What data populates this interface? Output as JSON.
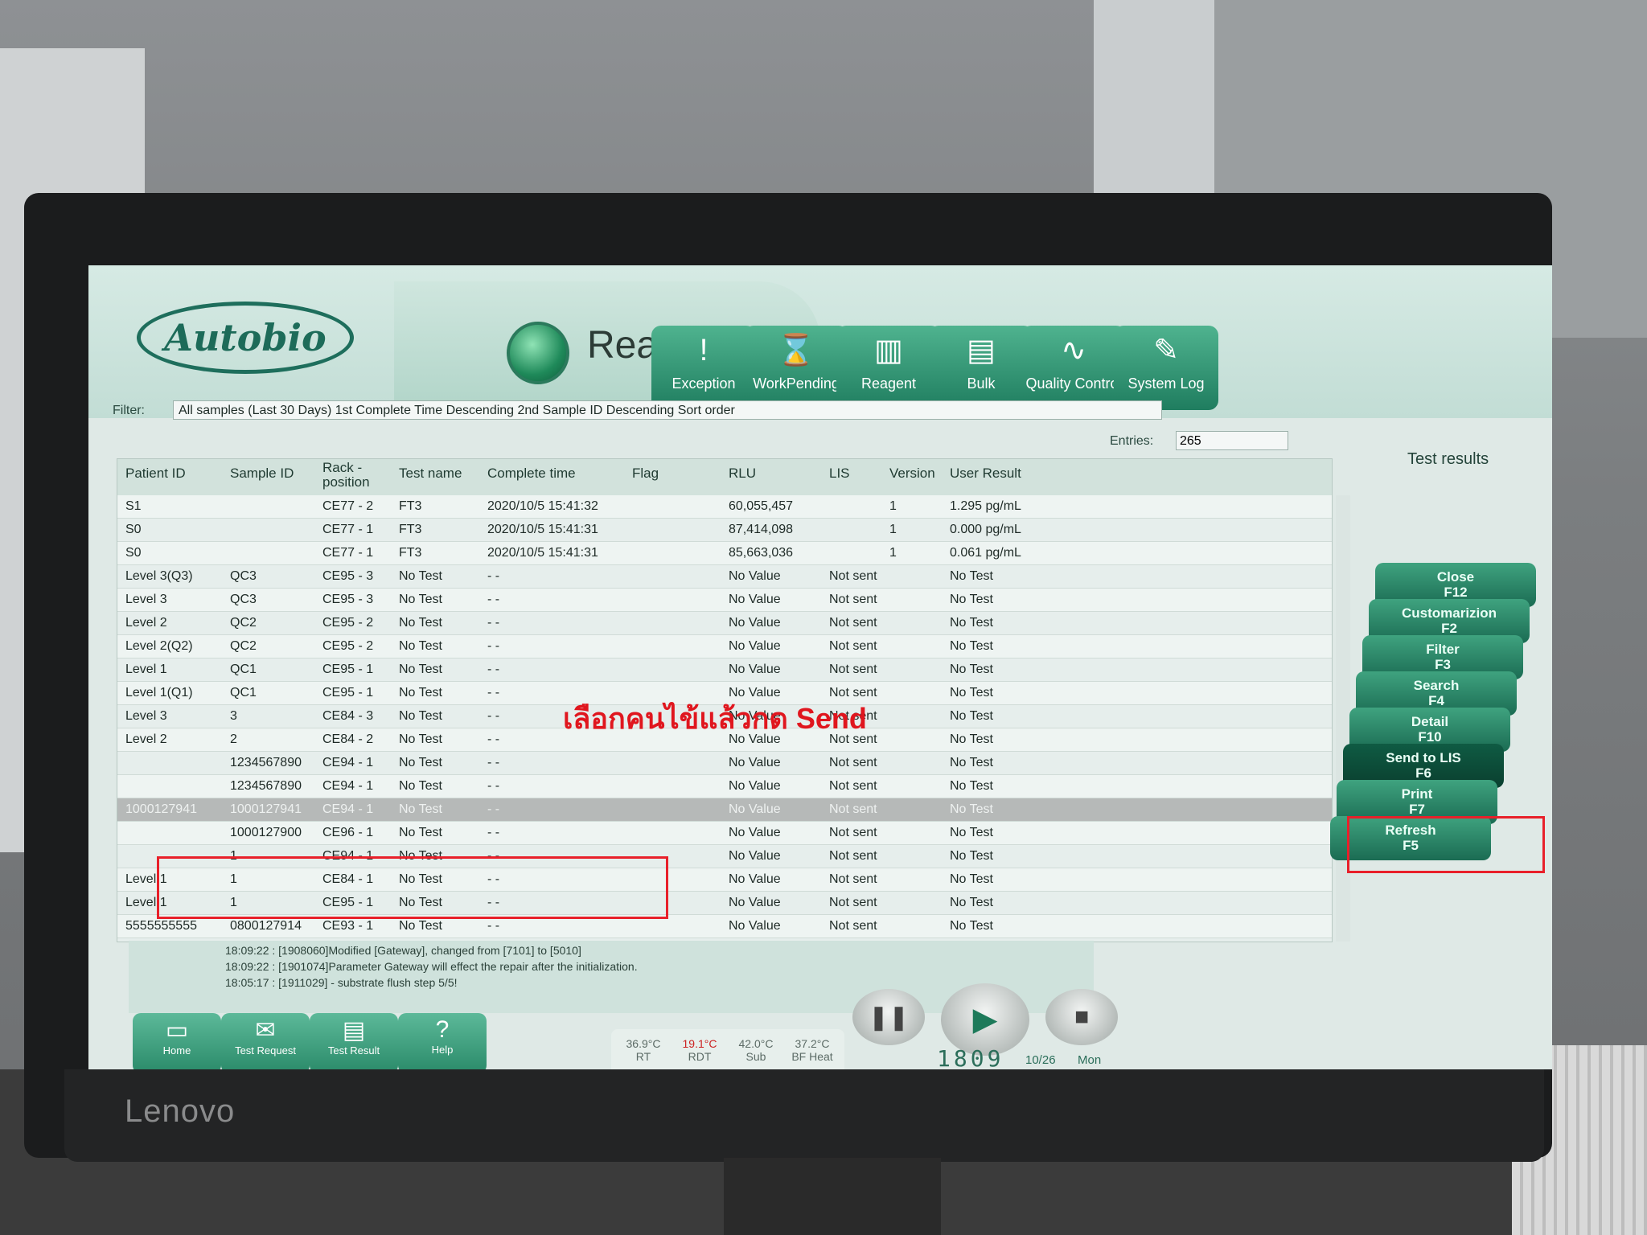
{
  "app": {
    "logo": "Autobio",
    "status": "Ready"
  },
  "top_buttons": [
    {
      "label": "Exception",
      "icon": "!"
    },
    {
      "label": "WorkPending",
      "icon": "⌛"
    },
    {
      "label": "Reagent",
      "icon": "▥"
    },
    {
      "label": "Bulk",
      "icon": "▤"
    },
    {
      "label": "Quality Control",
      "icon": "∿"
    },
    {
      "label": "System Log",
      "icon": "✎"
    }
  ],
  "filter": {
    "label": "Filter:",
    "value": "All samples (Last 30 Days)   1st Complete Time Descending 2nd Sample ID Descending Sort order",
    "entries_label": "Entries:",
    "entries_value": "265"
  },
  "panel_title": "Test results",
  "table": {
    "headers": {
      "patient_id": "Patient ID",
      "sample_id": "Sample ID",
      "rack": "Rack -\nposition",
      "test_name": "Test name",
      "complete_time": "Complete time",
      "flag": "Flag",
      "rlu": "RLU",
      "lis": "LIS",
      "version": "Version",
      "user_result": "User Result"
    },
    "rows": [
      {
        "patient": "S1",
        "sample": "",
        "rack": "CE77 - 2",
        "test": "FT3",
        "time": "2020/10/5 15:41:32",
        "flag": "",
        "rlu": "60,055,457",
        "lis": "",
        "version": "1",
        "result": "1.295 pg/mL"
      },
      {
        "patient": "S0",
        "sample": "",
        "rack": "CE77 - 1",
        "test": "FT3",
        "time": "2020/10/5 15:41:31",
        "flag": "",
        "rlu": "87,414,098",
        "lis": "",
        "version": "1",
        "result": "0.000 pg/mL"
      },
      {
        "patient": "S0",
        "sample": "",
        "rack": "CE77 - 1",
        "test": "FT3",
        "time": "2020/10/5 15:41:31",
        "flag": "",
        "rlu": "85,663,036",
        "lis": "",
        "version": "1",
        "result": "0.061 pg/mL"
      },
      {
        "patient": "Level 3(Q3)",
        "sample": "QC3",
        "rack": "CE95 - 3",
        "test": "No Test",
        "time": "- -",
        "flag": "",
        "rlu": "No Value",
        "lis": "Not sent",
        "version": "",
        "result": "No Test"
      },
      {
        "patient": "Level 3",
        "sample": "QC3",
        "rack": "CE95 - 3",
        "test": "No Test",
        "time": "- -",
        "flag": "",
        "rlu": "No Value",
        "lis": "Not sent",
        "version": "",
        "result": "No Test"
      },
      {
        "patient": "Level 2",
        "sample": "QC2",
        "rack": "CE95 - 2",
        "test": "No Test",
        "time": "- -",
        "flag": "",
        "rlu": "No Value",
        "lis": "Not sent",
        "version": "",
        "result": "No Test"
      },
      {
        "patient": "Level 2(Q2)",
        "sample": "QC2",
        "rack": "CE95 - 2",
        "test": "No Test",
        "time": "- -",
        "flag": "",
        "rlu": "No Value",
        "lis": "Not sent",
        "version": "",
        "result": "No Test"
      },
      {
        "patient": "Level 1",
        "sample": "QC1",
        "rack": "CE95 - 1",
        "test": "No Test",
        "time": "- -",
        "flag": "",
        "rlu": "No Value",
        "lis": "Not sent",
        "version": "",
        "result": "No Test"
      },
      {
        "patient": "Level 1(Q1)",
        "sample": "QC1",
        "rack": "CE95 - 1",
        "test": "No Test",
        "time": "- -",
        "flag": "",
        "rlu": "No Value",
        "lis": "Not sent",
        "version": "",
        "result": "No Test"
      },
      {
        "patient": "Level 3",
        "sample": "3",
        "rack": "CE84 - 3",
        "test": "No Test",
        "time": "- -",
        "flag": "",
        "rlu": "No Value",
        "lis": "Not sent",
        "version": "",
        "result": "No Test"
      },
      {
        "patient": "Level 2",
        "sample": "2",
        "rack": "CE84 - 2",
        "test": "No Test",
        "time": "- -",
        "flag": "",
        "rlu": "No Value",
        "lis": "Not sent",
        "version": "",
        "result": "No Test"
      },
      {
        "patient": "",
        "sample": "1234567890",
        "rack": "CE94 - 1",
        "test": "No Test",
        "time": "- -",
        "flag": "",
        "rlu": "No Value",
        "lis": "Not sent",
        "version": "",
        "result": "No Test"
      },
      {
        "patient": "",
        "sample": "1234567890",
        "rack": "CE94 - 1",
        "test": "No Test",
        "time": "- -",
        "flag": "",
        "rlu": "No Value",
        "lis": "Not sent",
        "version": "",
        "result": "No Test"
      },
      {
        "patient": "1000127941",
        "sample": "1000127941",
        "rack": "CE94 - 1",
        "test": "No Test",
        "time": "- -",
        "flag": "",
        "rlu": "No Value",
        "lis": "Not sent",
        "version": "",
        "result": "No Test",
        "selected": true
      },
      {
        "patient": "",
        "sample": "1000127900",
        "rack": "CE96 - 1",
        "test": "No Test",
        "time": "- -",
        "flag": "",
        "rlu": "No Value",
        "lis": "Not sent",
        "version": "",
        "result": "No Test"
      },
      {
        "patient": "",
        "sample": "1",
        "rack": "CE94 - 1",
        "test": "No Test",
        "time": "- -",
        "flag": "",
        "rlu": "No Value",
        "lis": "Not sent",
        "version": "",
        "result": "No Test"
      },
      {
        "patient": "Level 1",
        "sample": "1",
        "rack": "CE84 - 1",
        "test": "No Test",
        "time": "- -",
        "flag": "",
        "rlu": "No Value",
        "lis": "Not sent",
        "version": "",
        "result": "No Test"
      },
      {
        "patient": "Level 1",
        "sample": "1",
        "rack": "CE95 - 1",
        "test": "No Test",
        "time": "- -",
        "flag": "",
        "rlu": "No Value",
        "lis": "Not sent",
        "version": "",
        "result": "No Test"
      },
      {
        "patient": "5555555555",
        "sample": "0800127914",
        "rack": "CE93 - 1",
        "test": "No Test",
        "time": "- -",
        "flag": "",
        "rlu": "No Value",
        "lis": "Not sent",
        "version": "",
        "result": "No Test"
      }
    ]
  },
  "annotation": "เลือกคนไข้แล้วกด Send",
  "right_buttons": [
    {
      "label": "Close",
      "key": "F12"
    },
    {
      "label": "Customarizion",
      "key": "F2"
    },
    {
      "label": "Filter",
      "key": "F3"
    },
    {
      "label": "Search",
      "key": "F4"
    },
    {
      "label": "Detail",
      "key": "F10"
    },
    {
      "label": "Send to LIS",
      "key": "F6",
      "active": true
    },
    {
      "label": "Print",
      "key": "F7"
    },
    {
      "label": "Refresh",
      "key": "F5"
    }
  ],
  "log": [
    "18:09:22 : [1908060]Modified [Gateway], changed from [7101] to [5010]",
    "18:09:22 : [1901074]Parameter Gateway will effect the repair after the initialization.",
    "18:05:17 : [1911029] - substrate flush step 5/5!"
  ],
  "bottom_buttons": [
    {
      "label": "Home",
      "icon": "▭"
    },
    {
      "label": "Test Request",
      "icon": "✉"
    },
    {
      "label": "Test Result",
      "icon": "▤"
    },
    {
      "label": "Help",
      "icon": "?"
    }
  ],
  "temps": [
    {
      "value": "36.9°C",
      "label": "RT"
    },
    {
      "value": "19.1°C",
      "label": "RDT",
      "warn": true
    },
    {
      "value": "42.0°C",
      "label": "Sub"
    },
    {
      "value": "37.2°C",
      "label": "BF Heat"
    }
  ],
  "clock": {
    "time": "1809",
    "date": "10/26",
    "day": "Mon"
  },
  "monitor_brand": "Lenovo"
}
